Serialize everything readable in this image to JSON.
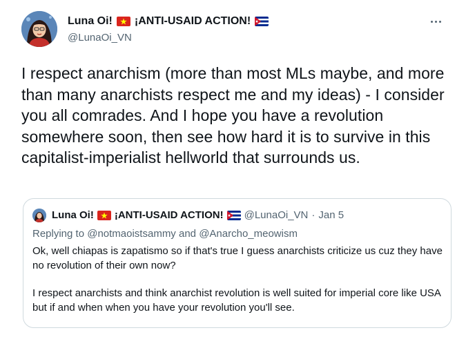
{
  "author": {
    "name": "Luna Oi!",
    "name_tag": "¡ANTI-USAID ACTION!",
    "handle": "@LunaOi_VN",
    "flags": [
      "vietnam-flag-icon",
      "cuba-flag-icon"
    ]
  },
  "tweet": {
    "text": "I respect anarchism (more than most MLs maybe, and more than many anarchists respect me and my ideas) - I consider you all comrades. And I hope you have a revolution somewhere soon, then see how hard it is to survive in this capitalist-imperialist hellworld that surrounds us."
  },
  "quoted_tweet": {
    "name": "Luna Oi!",
    "name_tag": "¡ANTI-USAID ACTION!",
    "handle": "@LunaOi_VN",
    "separator": "·",
    "date": "Jan 5",
    "replying_label": "Replying to",
    "reply_to_1": "@notmaoistsammy",
    "reply_and": "and",
    "reply_to_2": "@Anarcho_meowism",
    "paragraph_1": "Ok, well chiapas is zapatismo so if that's true I guess anarchists criticize us cuz they have no revolution of their own now?",
    "paragraph_2": "I respect anarchists and think anarchist revolution is well suited for imperial core like USA but if and when when you have your revolution you'll see."
  },
  "colors": {
    "text": "#0f1419",
    "secondary": "#536471",
    "border": "#cfd9de",
    "vn_red": "#da251d",
    "vn_star": "#ffff00",
    "cu_blue": "#002a8f",
    "cu_red": "#cf142b"
  }
}
